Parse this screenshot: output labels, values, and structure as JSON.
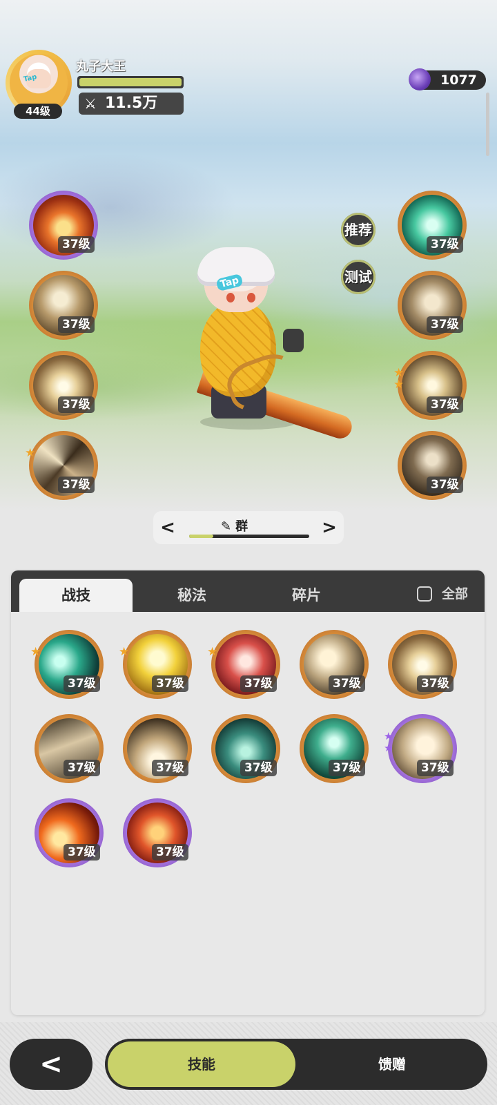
{
  "player": {
    "name": "丸子大王",
    "level": "44级",
    "power": "11.5万",
    "hp_fraction": 1.0,
    "avatar_tag": "Tap"
  },
  "currency": {
    "value": "1077",
    "icon": "purple-gem-icon"
  },
  "actions": {
    "recommend": "推荐",
    "test": "测试"
  },
  "character": {
    "tag": "Tap"
  },
  "equipped_left": [
    {
      "icon": "fire-skill-icon",
      "level": "37级",
      "rarity": "epic",
      "stars": 0
    },
    {
      "icon": "rock-strike-skill-icon",
      "level": "37级",
      "rarity": "normal",
      "stars": 0
    },
    {
      "icon": "burst-skill-icon",
      "level": "37级",
      "rarity": "normal",
      "stars": 0
    },
    {
      "icon": "whirlwind-skill-icon",
      "level": "37级",
      "rarity": "normal",
      "stars": 1
    }
  ],
  "equipped_right": [
    {
      "icon": "jade-sword-skill-icon",
      "level": "37级",
      "rarity": "normal",
      "stars": 0
    },
    {
      "icon": "sword-up-skill-icon",
      "level": "37级",
      "rarity": "normal",
      "stars": 0
    },
    {
      "icon": "eye-skill-icon",
      "level": "37级",
      "rarity": "normal",
      "stars": 2
    },
    {
      "icon": "sword-down-skill-icon",
      "level": "37级",
      "rarity": "normal",
      "stars": 0
    }
  ],
  "pager": {
    "prev": "<",
    "next": ">",
    "label": "群",
    "progress": 0.2
  },
  "tabs": [
    {
      "label": "战技",
      "active": true
    },
    {
      "label": "秘法",
      "active": false
    },
    {
      "label": "碎片",
      "active": false
    }
  ],
  "filter": {
    "label": "全部",
    "checked": false
  },
  "skills": [
    {
      "icon": "teal-slash-skill-icon",
      "level": "37级",
      "rarity": "normal",
      "stars": 1
    },
    {
      "icon": "gold-crystal-skill-icon",
      "level": "37级",
      "rarity": "normal",
      "stars": 1
    },
    {
      "icon": "red-swordsman-skill-icon",
      "level": "37级",
      "rarity": "normal",
      "stars": 1
    },
    {
      "icon": "crescent-slash-skill-icon",
      "level": "37级",
      "rarity": "normal",
      "stars": 0
    },
    {
      "icon": "blade-shine-skill-icon",
      "level": "37级",
      "rarity": "normal",
      "stars": 0
    },
    {
      "icon": "wind-slash-skill-icon",
      "level": "37级",
      "rarity": "normal",
      "stars": 0
    },
    {
      "icon": "spikes-skill-icon",
      "level": "37级",
      "rarity": "normal",
      "stars": 0
    },
    {
      "icon": "web-skill-icon",
      "level": "37级",
      "rarity": "normal",
      "stars": 0
    },
    {
      "icon": "green-sword-skill-icon",
      "level": "37级",
      "rarity": "normal",
      "stars": 0
    },
    {
      "icon": "beast-skill-icon",
      "level": "37级",
      "rarity": "epic",
      "stars": 2
    },
    {
      "icon": "flame-arc-skill-icon",
      "level": "37级",
      "rarity": "epic",
      "stars": 0
    },
    {
      "icon": "fire-sigil-skill-icon",
      "level": "37级",
      "rarity": "epic",
      "stars": 0
    }
  ],
  "footer": {
    "back": "<",
    "skill_tab": "技能",
    "gift_tab": "馈赠"
  },
  "colors": {
    "accent": "#c9d26a",
    "dark": "#2c2c2c",
    "orange_rim": "#d58b3a",
    "purple_rim": "#a774de"
  }
}
